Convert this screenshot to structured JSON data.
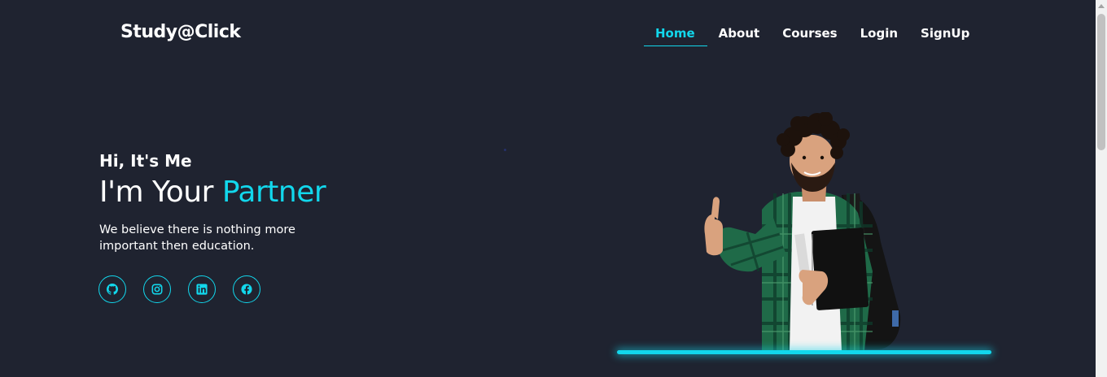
{
  "header": {
    "logo": "Study@Click",
    "nav": [
      {
        "label": "Home",
        "active": true
      },
      {
        "label": "About",
        "active": false
      },
      {
        "label": "Courses",
        "active": false
      },
      {
        "label": "Login",
        "active": false
      },
      {
        "label": "SignUp",
        "active": false
      }
    ]
  },
  "hero": {
    "greeting": "Hi, It's Me",
    "headline_prefix": "I'm Your ",
    "headline_accent": "Partner",
    "description": "We believe there is nothing more important then education.",
    "socials": [
      {
        "icon": "github-icon"
      },
      {
        "icon": "instagram-icon"
      },
      {
        "icon": "linkedin-icon"
      },
      {
        "icon": "facebook-icon"
      }
    ]
  },
  "colors": {
    "background": "#1f2330",
    "accent": "#12d7ec",
    "text": "#ffffff"
  }
}
